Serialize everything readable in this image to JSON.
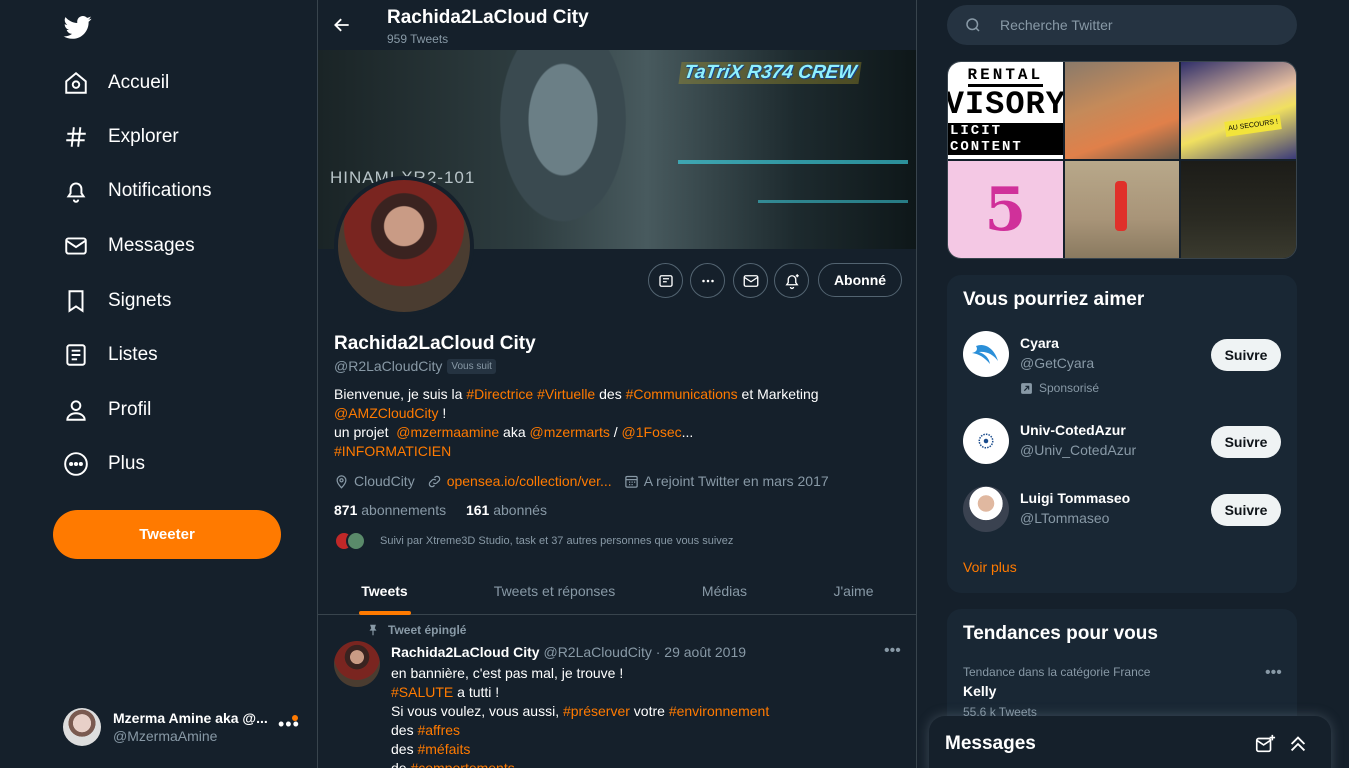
{
  "nav": {
    "items": [
      {
        "label": "Accueil",
        "icon": "home-icon"
      },
      {
        "label": "Explorer",
        "icon": "hashtag-icon"
      },
      {
        "label": "Notifications",
        "icon": "bell-icon"
      },
      {
        "label": "Messages",
        "icon": "envelope-icon"
      },
      {
        "label": "Signets",
        "icon": "bookmark-icon"
      },
      {
        "label": "Listes",
        "icon": "list-icon"
      },
      {
        "label": "Profil",
        "icon": "person-icon"
      },
      {
        "label": "Plus",
        "icon": "more-circle-icon"
      }
    ],
    "tweet_button": "Tweeter",
    "account": {
      "name": "Mzerma Amine aka @...",
      "handle": "@MzermaAmine"
    }
  },
  "header": {
    "title": "Rachida2LaCloud City",
    "tweet_count": "959 Tweets"
  },
  "banner": {
    "tag": "TaTriX R374 CREW",
    "signature": "HINAMI XR2-101"
  },
  "profile": {
    "name": "Rachida2LaCloud City",
    "handle": "@R2LaCloudCity",
    "follows_you": "Vous suit",
    "follow_button": "Abonné",
    "bio": {
      "l1_a": "Bienvenue, je suis la ",
      "l1_tag1": "#Directrice",
      "l1_tag2": "#Virtuelle",
      "l1_b": " des ",
      "l1_tag3": "#Communications",
      "l1_c": " et Marketing",
      "l2_mention": "@AMZCloudCity",
      "l2_b": " !",
      "l3_a": "un projet  ",
      "l3_mention1": "@mzermaamine",
      "l3_b": " aka ",
      "l3_mention2": "@mzermarts",
      "l3_c": " / ",
      "l3_mention3": "@1Fosec",
      "l3_d": "...",
      "l4_tag": "#INFORMATICIEN"
    },
    "location": "CloudCity",
    "website": "opensea.io/collection/ver...",
    "joined": "A rejoint Twitter en mars 2017",
    "following_count": "871",
    "following_label": " abonnements",
    "followers_count": "161",
    "followers_label": " abonnés",
    "followed_by": "Suivi par Xtreme3D Studio, task et 37 autres personnes que vous suivez"
  },
  "tabs": [
    "Tweets",
    "Tweets et réponses",
    "Médias",
    "J'aime"
  ],
  "tweet": {
    "pinned_label": "Tweet épinglé",
    "author": "Rachida2LaCloud City",
    "handle_date": " @R2LaCloudCity · 29 août 2019",
    "l1": "en bannière, c'est pas mal, je trouve !",
    "l2_tag": "#SALUTE",
    "l2_b": " a tutti !",
    "l3_a": "Si vous voulez, vous aussi, ",
    "l3_tag1": "#préserver",
    "l3_b": " votre ",
    "l3_tag2": "#environnement",
    "l4_a": "des ",
    "l4_tag": "#affres",
    "l5_a": "des ",
    "l5_tag": "#méfaits",
    "l6_a": "de ",
    "l6_tag": "#comportements"
  },
  "right": {
    "search_placeholder": "Recherche Twitter",
    "media": {
      "c1_l1": "RENTAL",
      "c1_l2": "VISORY",
      "c1_l3": "LICIT CONTENT",
      "c3_sign": "AU SECOURS !",
      "c4_digit": "5"
    },
    "who_to_follow": {
      "title": "Vous pourriez aimer",
      "follow_label": "Suivre",
      "sponsored": "Sponsorisé",
      "see_more": "Voir plus",
      "users": [
        {
          "name": "Cyara",
          "handle": "@GetCyara"
        },
        {
          "name": "Univ-CotedAzur",
          "handle": "@Univ_CotedAzur"
        },
        {
          "name": "Luigi Tommaseo",
          "handle": "@LTommaseo"
        }
      ]
    },
    "trends": {
      "title": "Tendances pour vous",
      "category": "Tendance dans la catégorie France",
      "name": "Kelly",
      "count": "55,6 k Tweets"
    }
  },
  "messages_drawer": {
    "title": "Messages"
  },
  "colors": {
    "accent": "#ff7a00",
    "background": "#15202b",
    "panel": "#192734",
    "muted": "#8899a6"
  }
}
